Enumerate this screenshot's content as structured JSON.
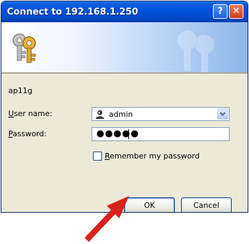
{
  "window": {
    "title": "Connect to 192.168.1.250",
    "help_symbol": "?",
    "close_symbol": "✕"
  },
  "dialog": {
    "realm": "ap11g",
    "username_label_u": "U",
    "username_label_rest": "ser name:",
    "username_value": "admin",
    "password_label_u": "P",
    "password_label_rest": "assword:",
    "password_value": "●●●●●",
    "remember_label_u": "R",
    "remember_label_rest": "emember my password",
    "remember_checked": false,
    "ok_label": "OK",
    "cancel_label": "Cancel"
  },
  "colors": {
    "titlebar": "#0252d8",
    "dialog_bg": "#ece9d8",
    "annotation_arrow": "#d8221c"
  },
  "icons": {
    "banner": "keys-icon",
    "user": "user-icon",
    "dropdown": "chevron-down-icon",
    "annotation": "red-arrow-icon"
  }
}
